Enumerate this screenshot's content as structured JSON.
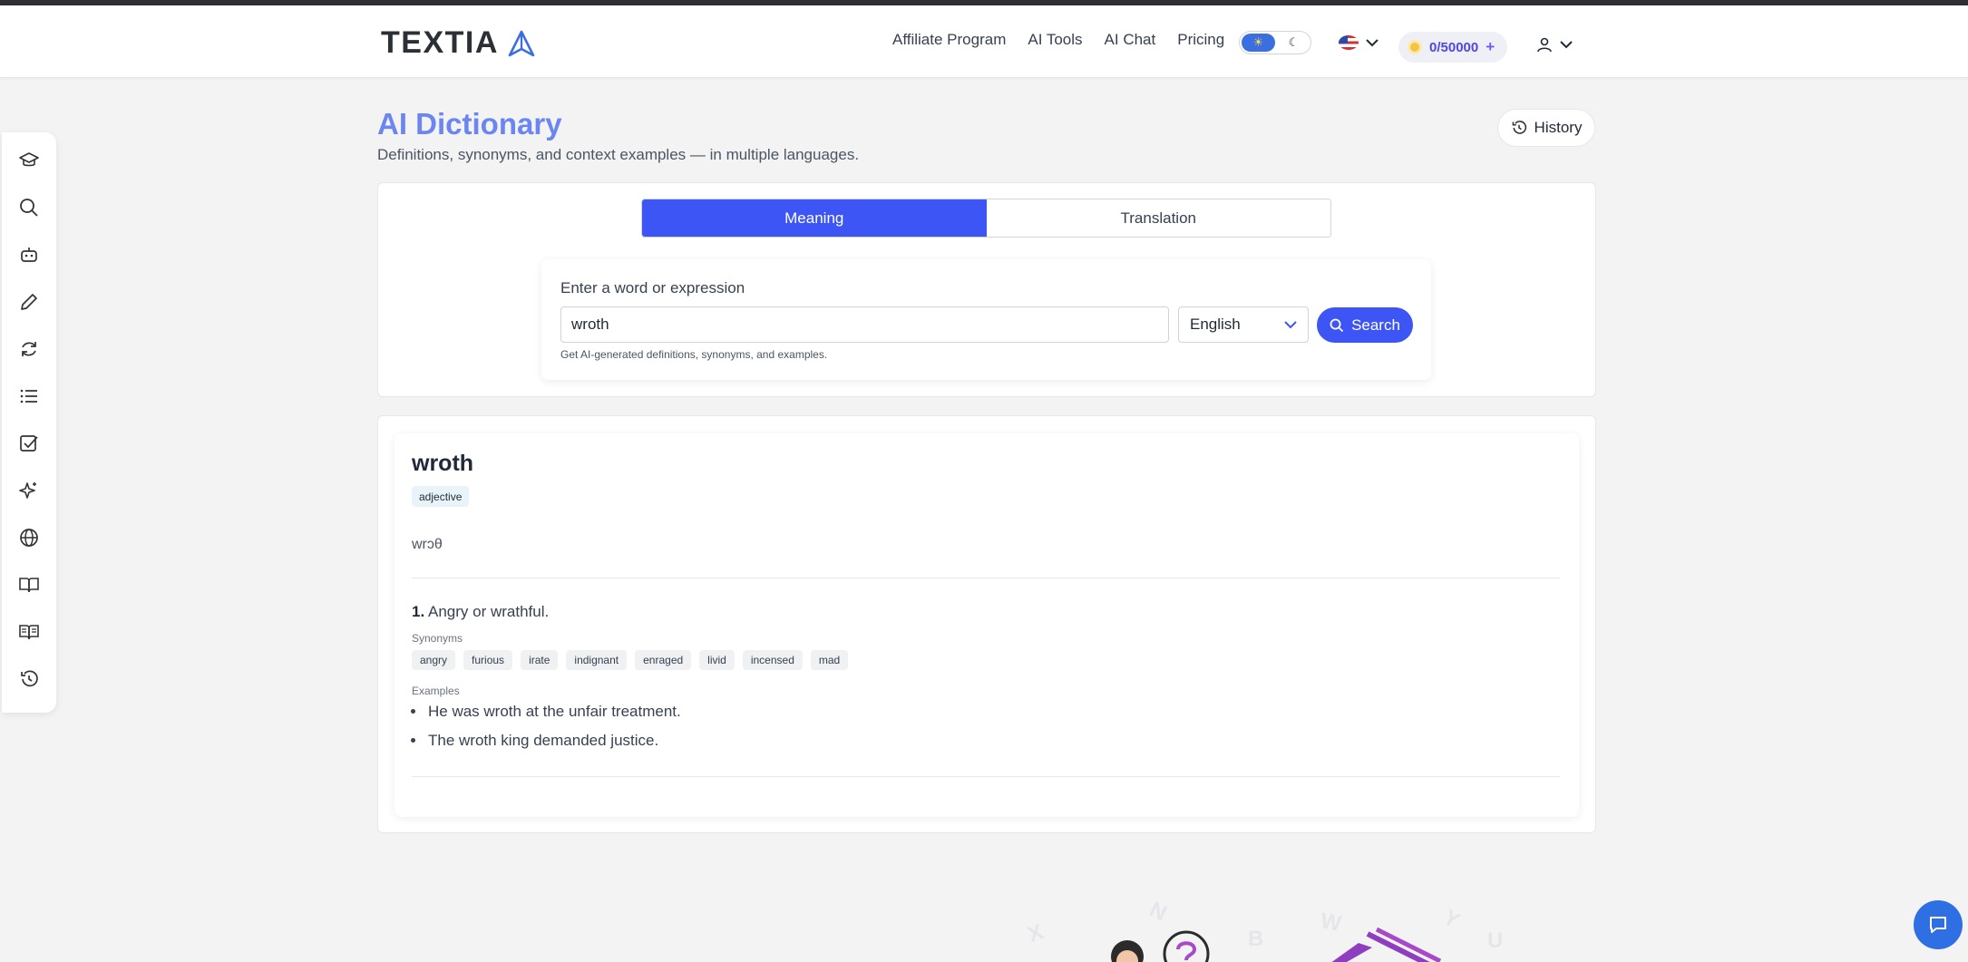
{
  "app": {
    "brand": "TEXTIA"
  },
  "nav": {
    "links": [
      "Affiliate Program",
      "AI Tools",
      "AI Chat",
      "Pricing"
    ]
  },
  "credits": {
    "value": "0/50000",
    "plus": "+"
  },
  "theme": {
    "light_icon": "☀",
    "dark_icon": "☾"
  },
  "page": {
    "title": "AI Dictionary",
    "subtitle": "Definitions, synonyms, and context examples — in multiple languages.",
    "history_label": "History"
  },
  "tabs": [
    {
      "label": "Meaning",
      "active": true
    },
    {
      "label": "Translation",
      "active": false
    }
  ],
  "search": {
    "label": "Enter a word or expression",
    "value": "wroth",
    "language": "English",
    "button": "Search",
    "hint": "Get AI-generated definitions, synonyms, and examples."
  },
  "result": {
    "word": "wroth",
    "part_of_speech": "adjective",
    "phonetic": "wrɔθ",
    "definition_number": "1.",
    "definition": "Angry or wrathful.",
    "synonyms_label": "Synonyms",
    "synonyms": [
      "angry",
      "furious",
      "irate",
      "indignant",
      "enraged",
      "livid",
      "incensed",
      "mad"
    ],
    "examples_label": "Examples",
    "examples": [
      "He was wroth at the unfair treatment.",
      "The wroth king demanded justice."
    ]
  },
  "sidebar_icons": [
    "graduation-cap-icon",
    "search-icon",
    "robot-icon",
    "pencil-icon",
    "refresh-icon",
    "list-icon",
    "checkbox-icon",
    "sparkles-icon",
    "globe-icon",
    "book-open-icon",
    "book-text-icon",
    "history-icon"
  ],
  "colors": {
    "primary": "#3d55f5",
    "title": "#6b86f0",
    "chat_fab": "#2f6fe4"
  }
}
